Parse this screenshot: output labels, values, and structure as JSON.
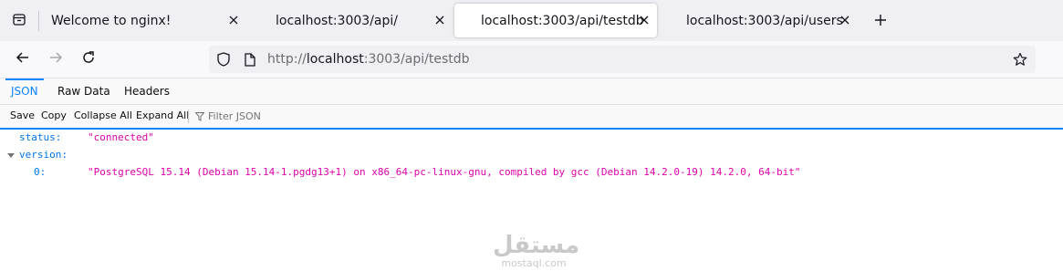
{
  "browser": {
    "tabs": [
      {
        "title": "Welcome to nginx!",
        "active": false
      },
      {
        "title": "localhost:3003/api/",
        "active": false
      },
      {
        "title": "localhost:3003/api/testdb",
        "active": true
      },
      {
        "title": "localhost:3003/api/users",
        "active": false
      }
    ],
    "new_tab_symbol": "+",
    "url": {
      "scheme": "http://",
      "host": "localhost",
      "rest": ":3003/api/testdb"
    }
  },
  "viewer": {
    "tabs": [
      "JSON",
      "Raw Data",
      "Headers"
    ],
    "selected_tab": "JSON",
    "toolbar": {
      "save": "Save",
      "copy": "Copy",
      "collapse_all": "Collapse All",
      "expand_all": "Expand All",
      "filter_placeholder": "Filter JSON"
    }
  },
  "json": {
    "status_key": "status:",
    "status_value": "\"connected\"",
    "version_key": "version:",
    "version_index": "0:",
    "version_value": "\"PostgreSQL 15.14 (Debian 15.14-1.pgdg13+1) on x86_64-pc-linux-gnu, compiled by gcc (Debian 14.2.0-19) 14.2.0, 64-bit\""
  },
  "watermark": {
    "main": "مستقل",
    "sub": "mostaql.com"
  },
  "colors": {
    "accent": "#0a84ff",
    "json_key": "#0074e8",
    "json_string": "#dd00a9"
  },
  "icons": [
    "tab-overview-icon",
    "close-icon",
    "plus-icon",
    "back-arrow-icon",
    "forward-arrow-icon",
    "reload-icon",
    "shield-icon",
    "page-icon",
    "star-icon",
    "filter-icon",
    "expand-twisty-icon"
  ]
}
